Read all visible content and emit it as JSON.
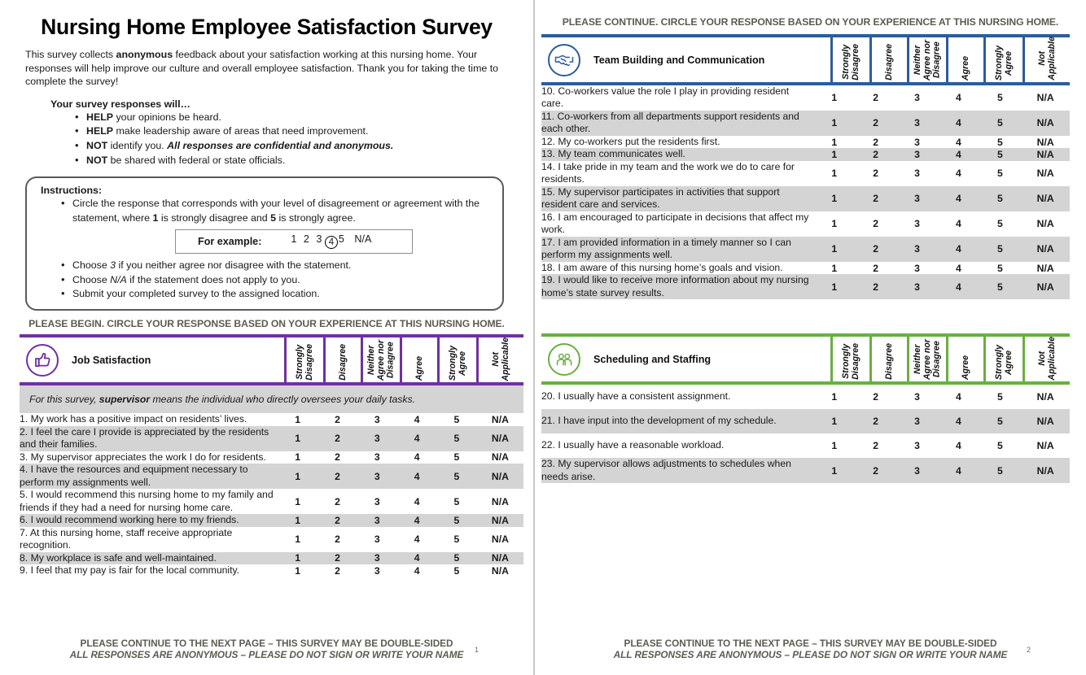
{
  "document": {
    "title": "Nursing Home Employee Satisfaction Survey",
    "intro_part1": "This survey collects ",
    "intro_bold": "anonymous",
    "intro_part2": " feedback about your satisfaction working at this nursing home. Your responses will help improve our culture and overall employee satisfaction. Thank you for taking the time to complete the survey!",
    "responses_heading": "Your survey responses will…",
    "bullets": [
      {
        "bold": "HELP",
        "rest": " your opinions be heard.",
        "italic": ""
      },
      {
        "bold": "HELP",
        "rest": " make leadership aware of areas that need improvement.",
        "italic": ""
      },
      {
        "bold": "NOT",
        "rest": " identify you. ",
        "italic": "All responses are confidential and anonymous."
      },
      {
        "bold": "NOT",
        "rest": " be shared with federal or state officials.",
        "italic": ""
      }
    ]
  },
  "instructions": {
    "title": "Instructions:",
    "item1_a": "Circle the response that corresponds with your level of disagreement or agreement with the statement, where ",
    "item1_b": "1",
    "item1_c": " is strongly disagree and ",
    "item1_d": "5",
    "item1_e": " is strongly agree.",
    "example_label": "For example:",
    "example_numbers": "1  2  3",
    "example_circled": "4",
    "example_after": "5",
    "example_na": "N/A",
    "item2_a": "Choose ",
    "item2_b": "3",
    "item2_c": " if you neither agree nor disagree with the statement.",
    "item3_a": "Choose ",
    "item3_b": "N/A",
    "item3_c": " if the statement does not apply to you.",
    "item4": "Submit your completed survey to the assigned location."
  },
  "banners": {
    "begin": "PLEASE BEGIN. CIRCLE YOUR RESPONSE BASED ON YOUR EXPERIENCE AT THIS NURSING HOME.",
    "continue": "PLEASE CONTINUE. CIRCLE YOUR RESPONSE BASED ON YOUR EXPERIENCE AT THIS NURSING HOME."
  },
  "scale_headers": [
    "Strongly\nDisagree",
    "Disagree",
    "Neither\nAgree nor\nDisagree",
    "Agree",
    "Strongly\nAgree",
    "Not\nApplicable"
  ],
  "options": [
    "1",
    "2",
    "3",
    "4",
    "5",
    "N/A"
  ],
  "colors": {
    "job_satisfaction_accent": "#7030A0",
    "team_building_accent": "#2E5C9A",
    "scheduling_accent": "#6AAE44",
    "row_shade": "#d4d4d4",
    "footer_text": "#5c5c52"
  },
  "sections": [
    {
      "id": "job-satisfaction",
      "title": "Job Satisfaction",
      "icon": "thumbs-up-icon",
      "accent": "#7030A0",
      "note_a": "For this survey, ",
      "note_b": "supervisor",
      "note_c": " means the individual who directly oversees your daily tasks.",
      "questions": [
        {
          "num": "1.",
          "text": "My work has a positive impact on residents’ lives."
        },
        {
          "num": "2.",
          "text": "I feel the care I provide is appreciated by the residents and their families."
        },
        {
          "num": "3.",
          "text": "My supervisor appreciates the work I do for residents."
        },
        {
          "num": "4.",
          "text": "I have the resources and equipment necessary to perform my assignments well."
        },
        {
          "num": "5.",
          "text": "I would recommend this nursing home to my family and friends if they had a need for nursing home care."
        },
        {
          "num": "6.",
          "text": "I would recommend working here to my friends."
        },
        {
          "num": "7.",
          "text": "At this nursing home, staff receive appropriate recognition."
        },
        {
          "num": "8.",
          "text": "My workplace is safe and well-maintained."
        },
        {
          "num": "9.",
          "text": "I feel that my pay is fair for the local community."
        }
      ]
    },
    {
      "id": "team-building",
      "title": "Team Building and Communication",
      "icon": "handshake-icon",
      "accent": "#2E5C9A",
      "questions": [
        {
          "num": "10.",
          "text": "Co-workers value the role I play in providing resident care."
        },
        {
          "num": "11.",
          "text": "Co-workers from all departments support residents and each other."
        },
        {
          "num": "12.",
          "text": "My co-workers put the residents first."
        },
        {
          "num": "13.",
          "text": "My team communicates well."
        },
        {
          "num": "14.",
          "text": "I take pride in my team and the work we do to care for residents."
        },
        {
          "num": "15.",
          "text": "My supervisor participates in activities that support resident care and services."
        },
        {
          "num": "16.",
          "text": "I am encouraged to participate in decisions that affect my work."
        },
        {
          "num": "17.",
          "text": "I am provided information in a timely manner so I can perform my assignments well."
        },
        {
          "num": "18.",
          "text": "I am aware of this nursing home’s goals and vision."
        },
        {
          "num": "19.",
          "text": "I would like to receive more information about my nursing home’s state survey results."
        }
      ]
    },
    {
      "id": "scheduling-staffing",
      "title": "Scheduling and Staffing",
      "icon": "people-icon",
      "accent": "#6AAE44",
      "questions": [
        {
          "num": "20.",
          "text": "I usually have a consistent assignment."
        },
        {
          "num": "21.",
          "text": "I have input into the development of my schedule."
        },
        {
          "num": "22.",
          "text": "I usually have a reasonable workload."
        },
        {
          "num": "23.",
          "text": "My supervisor allows adjustments to schedules when needs arise."
        }
      ]
    }
  ],
  "footer": {
    "line1": "PLEASE CONTINUE TO THE NEXT PAGE – THIS SURVEY MAY BE DOUBLE-SIDED",
    "line2": "ALL RESPONSES ARE ANONYMOUS – PLEASE DO NOT SIGN OR WRITE YOUR NAME",
    "page1_number": "1",
    "page2_number": "2"
  }
}
